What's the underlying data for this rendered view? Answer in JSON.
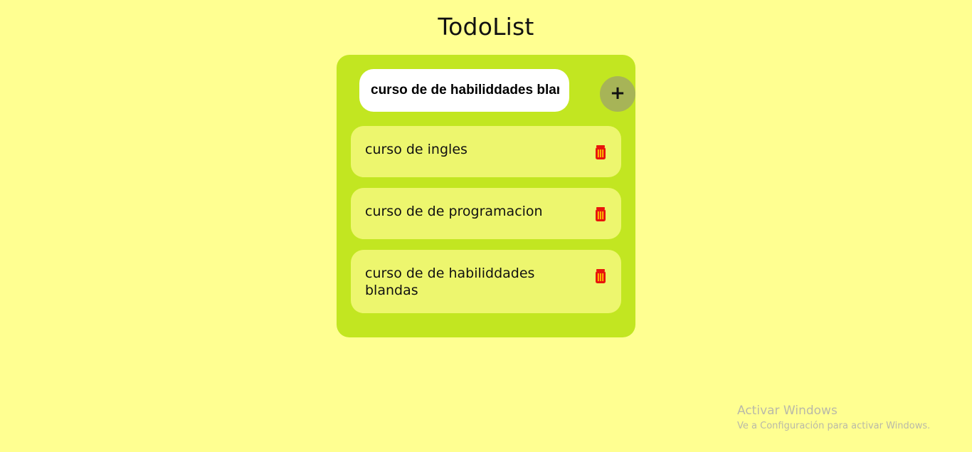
{
  "app": {
    "title": "TodoList"
  },
  "input": {
    "value": "curso de de habiliddades blandas",
    "placeholder": ""
  },
  "add_button": {
    "label": "+"
  },
  "tasks": [
    {
      "text": "curso de ingles",
      "delete_icon": "trash-icon"
    },
    {
      "text": "curso de de programacion",
      "delete_icon": "trash-icon"
    },
    {
      "text": "curso de de habiliddades blandas",
      "delete_icon": "trash-icon"
    }
  ],
  "watermark": {
    "title": "Activar Windows",
    "subtitle": "Ve a Configuración para activar Windows."
  },
  "colors": {
    "background": "#ffff91",
    "panel": "#c2e621",
    "task_item": "#edf66e",
    "add_button": "#a7b457",
    "delete_icon": "#e8150c"
  }
}
